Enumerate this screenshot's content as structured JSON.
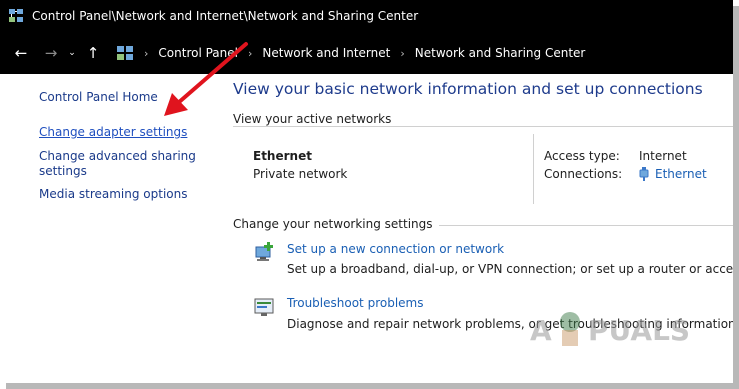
{
  "window": {
    "title": "Control Panel\\Network and Internet\\Network and Sharing Center"
  },
  "nav": {
    "breadcrumbs": [
      "Control Panel",
      "Network and Internet",
      "Network and Sharing Center"
    ]
  },
  "left_pane": {
    "items": [
      {
        "label": "Control Panel Home"
      },
      {
        "label": "Change adapter settings"
      },
      {
        "label_line1": "Change advanced sharing",
        "label_line2": "settings"
      },
      {
        "label": "Media streaming options"
      }
    ]
  },
  "main": {
    "heading": "View your basic network information and set up connections",
    "active_networks_title": "View your active networks",
    "network": {
      "name": "Ethernet",
      "category": "Private network",
      "access_type_label": "Access type:",
      "access_type_value": "Internet",
      "connections_label": "Connections:",
      "connections_value": "Ethernet"
    },
    "change_settings_title": "Change your networking settings",
    "tasks": [
      {
        "link": "Set up a new connection or network",
        "desc": "Set up a broadband, dial-up, or VPN connection; or set up a router or access point."
      },
      {
        "link": "Troubleshoot problems",
        "desc": "Diagnose and repair network problems, or get troubleshooting information."
      }
    ]
  },
  "watermark": {
    "text": "A  PUALS"
  },
  "colors": {
    "titlebar": "#000000",
    "link": "#1a5fb4",
    "heading": "#1e3b8c",
    "arrow": "#e0141e"
  }
}
